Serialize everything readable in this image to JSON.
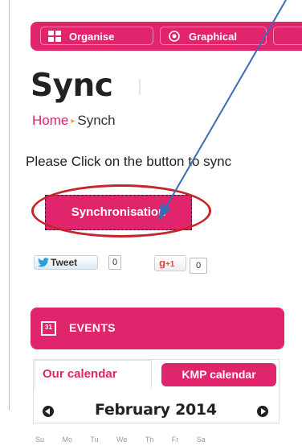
{
  "nav": {
    "organise_label": "Organise",
    "graphical_label": "Graphical"
  },
  "page": {
    "title": "Sync",
    "breadcrumb_home": "Home",
    "breadcrumb_sep": "▸",
    "breadcrumb_current": "Synch",
    "intro_text": "Please Click on the button to sync",
    "sync_button_label": "Synchronisation"
  },
  "social": {
    "tweet_label": "Tweet",
    "tweet_count": "0",
    "gplus_label": "g",
    "gplus_suffix": "+1",
    "gplus_count": "0"
  },
  "events": {
    "title": "EVENTS",
    "icon_day": "31",
    "tab_our": "Our calendar",
    "tab_kmp": "KMP calendar",
    "month": "February 2014",
    "weekdays": "Su Mo Tu We Th Fr Sa"
  },
  "colors": {
    "accent": "#e0256c",
    "annotation_ring": "#c1272d",
    "annotation_arrow": "#3b6bb5"
  }
}
